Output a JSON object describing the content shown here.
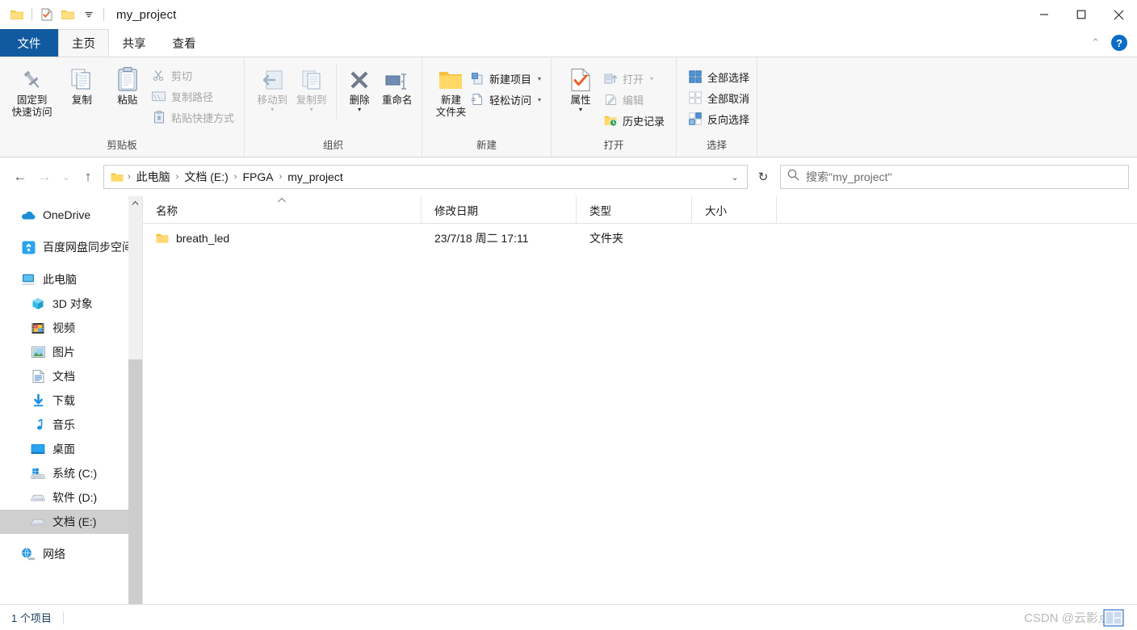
{
  "window": {
    "title": "my_project",
    "minimize": "—",
    "maximize": "☐",
    "close": "✕"
  },
  "quick_access": {
    "folder_label": "folder-icon",
    "properties_label": "properties-icon",
    "new_folder_label": "new-folder-icon",
    "dropdown_label": "☰"
  },
  "tabs": [
    {
      "label": "文件",
      "id": "file"
    },
    {
      "label": "主页",
      "id": "home"
    },
    {
      "label": "共享",
      "id": "share"
    },
    {
      "label": "查看",
      "id": "view"
    }
  ],
  "tab_right": {
    "collapse": "⌃",
    "help": "?"
  },
  "ribbon": {
    "groups": [
      {
        "title": "剪贴板",
        "big": [
          {
            "label_top": "固定到",
            "label_bottom": "快速访问",
            "icon": "pin-icon",
            "disabled": false
          },
          {
            "label_top": "复制",
            "label_bottom": "",
            "icon": "copy-icon",
            "disabled": false
          },
          {
            "label_top": "粘贴",
            "label_bottom": "",
            "icon": "paste-icon",
            "disabled": false
          }
        ],
        "small": [
          {
            "label": "剪切",
            "icon": "scissors-icon",
            "disabled": true
          },
          {
            "label": "复制路径",
            "icon": "copy-path-icon",
            "disabled": true
          },
          {
            "label": "粘贴快捷方式",
            "icon": "paste-shortcut-icon",
            "disabled": true
          }
        ]
      },
      {
        "title": "组织",
        "big": [
          {
            "label_top": "移动到",
            "label_bottom": "",
            "icon": "move-to-icon",
            "disabled": true,
            "caret": true
          },
          {
            "label_top": "复制到",
            "label_bottom": "",
            "icon": "copy-to-icon",
            "disabled": true,
            "caret": true
          },
          {
            "label_top": "删除",
            "label_bottom": "",
            "icon": "delete-icon",
            "disabled": false,
            "caret": true
          },
          {
            "label_top": "重命名",
            "label_bottom": "",
            "icon": "rename-icon",
            "disabled": false
          }
        ],
        "small": []
      },
      {
        "title": "新建",
        "big": [
          {
            "label_top": "新建",
            "label_bottom": "文件夹",
            "icon": "new-folder-icon",
            "disabled": false
          }
        ],
        "small": [
          {
            "label": "新建项目",
            "icon": "new-item-icon",
            "disabled": false,
            "caret": true
          },
          {
            "label": "轻松访问",
            "icon": "easy-access-icon",
            "disabled": false,
            "caret": true
          }
        ]
      },
      {
        "title": "打开",
        "big": [
          {
            "label_top": "属性",
            "label_bottom": "",
            "icon": "properties-icon",
            "disabled": false,
            "caret": true
          }
        ],
        "small": [
          {
            "label": "打开",
            "icon": "open-icon",
            "disabled": true,
            "caret": true
          },
          {
            "label": "编辑",
            "icon": "edit-icon",
            "disabled": true
          },
          {
            "label": "历史记录",
            "icon": "history-icon",
            "disabled": false
          }
        ]
      },
      {
        "title": "选择",
        "big": [],
        "small": [
          {
            "label": "全部选择",
            "icon": "select-all-icon",
            "disabled": false
          },
          {
            "label": "全部取消",
            "icon": "select-none-icon",
            "disabled": false
          },
          {
            "label": "反向选择",
            "icon": "invert-selection-icon",
            "disabled": false
          }
        ]
      }
    ]
  },
  "addressbar": {
    "back": "←",
    "forward": "→",
    "recent": "⌄",
    "up": "↑",
    "crumbs": [
      "此电脑",
      "文档 (E:)",
      "FPGA",
      "my_project"
    ],
    "separator": "›",
    "dropdown": "⌄",
    "refresh": "↻",
    "search_placeholder": "搜索\"my_project\""
  },
  "navpane": {
    "items": [
      {
        "label": "OneDrive",
        "icon": "onedrive-icon",
        "level": 1,
        "selected": false,
        "spacer_after": true
      },
      {
        "label": "百度网盘同步空间",
        "icon": "baidu-netdisk-icon",
        "level": 1,
        "selected": false,
        "spacer_after": true
      },
      {
        "label": "此电脑",
        "icon": "this-pc-icon",
        "level": 1,
        "selected": false
      },
      {
        "label": "3D 对象",
        "icon": "3d-objects-icon",
        "level": 2,
        "selected": false
      },
      {
        "label": "视频",
        "icon": "videos-icon",
        "level": 2,
        "selected": false
      },
      {
        "label": "图片",
        "icon": "pictures-icon",
        "level": 2,
        "selected": false
      },
      {
        "label": "文档",
        "icon": "documents-icon",
        "level": 2,
        "selected": false
      },
      {
        "label": "下载",
        "icon": "downloads-icon",
        "level": 2,
        "selected": false
      },
      {
        "label": "音乐",
        "icon": "music-icon",
        "level": 2,
        "selected": false
      },
      {
        "label": "桌面",
        "icon": "desktop-icon",
        "level": 2,
        "selected": false
      },
      {
        "label": "系统 (C:)",
        "icon": "windows-drive-icon",
        "level": 2,
        "selected": false
      },
      {
        "label": "软件 (D:)",
        "icon": "drive-icon",
        "level": 2,
        "selected": false
      },
      {
        "label": "文档 (E:)",
        "icon": "drive-icon",
        "level": 2,
        "selected": true,
        "spacer_after": true
      },
      {
        "label": "网络",
        "icon": "network-icon",
        "level": 1,
        "selected": false
      }
    ]
  },
  "filelist": {
    "columns": [
      {
        "label": "名称",
        "key": "name",
        "sorted": true,
        "sort_dir": "asc"
      },
      {
        "label": "修改日期",
        "key": "date"
      },
      {
        "label": "类型",
        "key": "type"
      },
      {
        "label": "大小",
        "key": "size"
      }
    ],
    "rows": [
      {
        "name": "breath_led",
        "date": "23/7/18 周二 17:11",
        "type": "文件夹",
        "size": "",
        "icon": "folder-icon"
      }
    ]
  },
  "statusbar": {
    "item_count": "1 个项目",
    "watermark": "CSDN @云影点灯"
  },
  "colors": {
    "accent": "#125aa0",
    "folder_yellow": "#ffd04c",
    "selection_gray": "#cfcfcf",
    "ribbon_bg": "#f7f7f7",
    "help_blue": "#0a6cc4"
  }
}
